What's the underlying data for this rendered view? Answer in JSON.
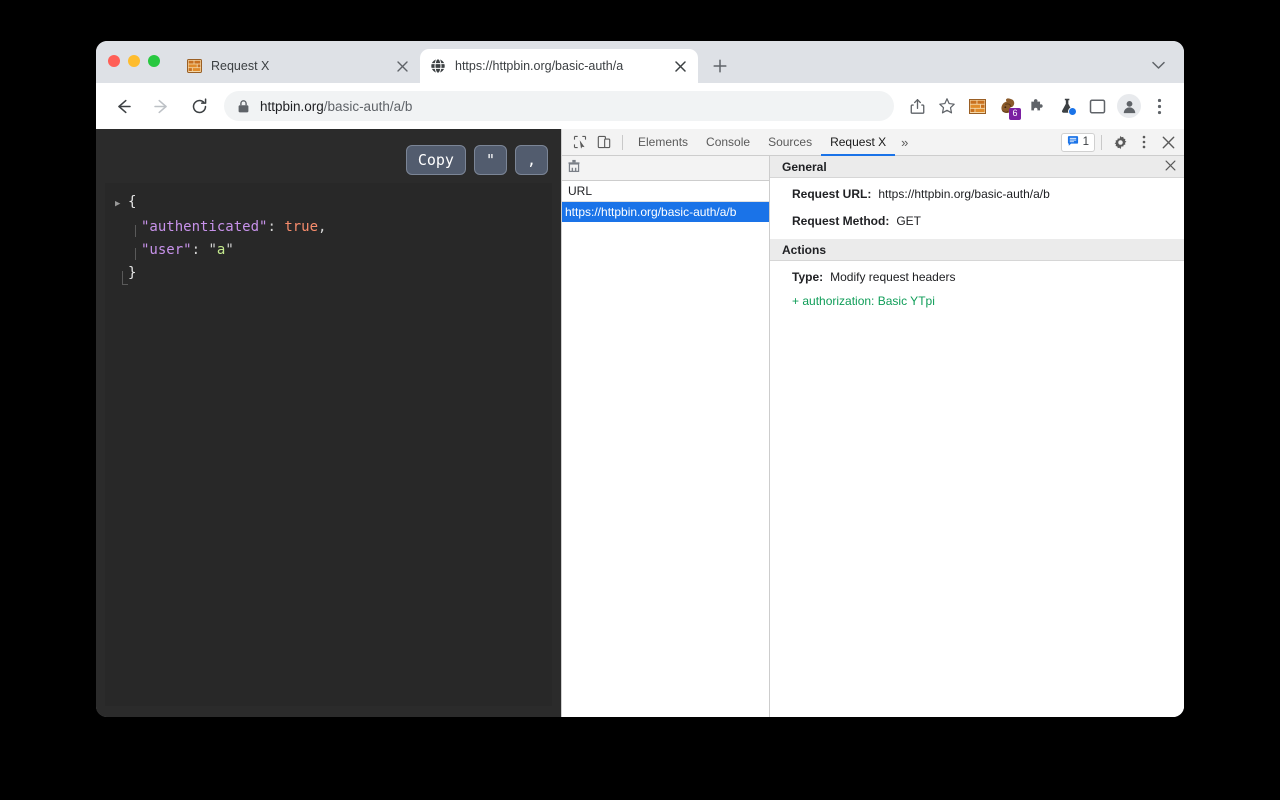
{
  "browser": {
    "tabs": [
      {
        "title": "Request X",
        "favicon": "brick-wall-icon",
        "active": false
      },
      {
        "title": "https://httpbin.org/basic-auth/a",
        "favicon": "globe-icon",
        "active": true
      }
    ],
    "newtab_label": "+",
    "tabstrip_chevron": "⌄",
    "toolbar": {
      "back_icon": "back-arrow-icon",
      "forward_icon": "forward-arrow-icon",
      "reload_icon": "reload-icon",
      "lock_icon": "lock-icon",
      "url_domain": "httpbin.org",
      "url_path": "/basic-auth/a/b",
      "icons": [
        {
          "name": "share-icon"
        },
        {
          "name": "bookmark-star-icon"
        },
        {
          "name": "brick-wall-extension-icon"
        },
        {
          "name": "squirrel-extension-icon",
          "badge": "6"
        },
        {
          "name": "puzzle-extensions-icon"
        },
        {
          "name": "beaker-extension-icon",
          "dot": true
        },
        {
          "name": "side-panel-icon"
        },
        {
          "name": "profile-avatar-icon"
        },
        {
          "name": "chrome-menu-icon"
        }
      ]
    }
  },
  "json_viewer": {
    "buttons": {
      "copy": "Copy",
      "quote": "\"",
      "comma": ","
    },
    "lines": {
      "open_brace": "{",
      "key_authenticated": "\"authenticated\"",
      "colon": ":",
      "value_true": "true",
      "comma": ",",
      "key_user": "\"user\"",
      "value_user": "a",
      "quote": "\"",
      "close_brace": "}"
    }
  },
  "devtools": {
    "inspect_icon": "inspect-element-icon",
    "device_icon": "device-toolbar-icon",
    "tabs": [
      {
        "label": "Elements",
        "active": false
      },
      {
        "label": "Console",
        "active": false
      },
      {
        "label": "Sources",
        "active": false
      },
      {
        "label": "Request X",
        "active": true
      }
    ],
    "overflow_label": "»",
    "message_count": "1",
    "message_icon": "message-bubble-icon",
    "settings_icon": "gear-icon",
    "kebab_icon": "more-options-icon",
    "close_icon": "close-icon",
    "list": {
      "clear_icon": "clear-broom-icon",
      "column_header": "URL",
      "rows": [
        {
          "url": "https://httpbin.org/basic-auth/a/b",
          "selected": true
        }
      ]
    },
    "detail": {
      "general_title": "General",
      "general_close_icon": "close-icon",
      "request_url_label": "Request URL:",
      "request_url_value": "https://httpbin.org/basic-auth/a/b",
      "request_method_label": "Request Method:",
      "request_method_value": "GET",
      "actions_title": "Actions",
      "type_label": "Type:",
      "type_value": "Modify request headers",
      "added_header": "+ authorization: Basic YTpi"
    }
  },
  "colors": {
    "accent_blue": "#1a73e8",
    "green": "#0f9d58",
    "purple_badge": "#7b1fa2",
    "json_bg": "#282828",
    "page_bg": "#2b2b2b"
  }
}
